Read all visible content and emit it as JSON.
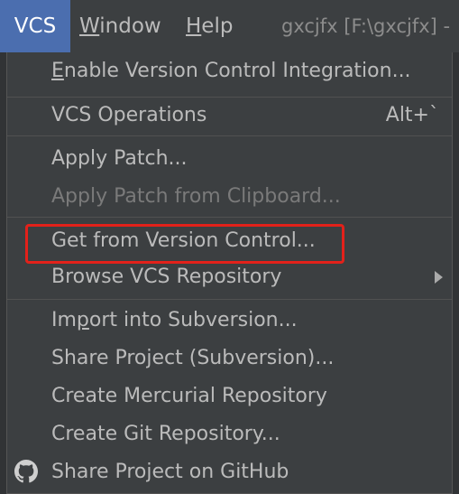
{
  "menubar": {
    "vcs": "VCS",
    "window_mnemonic": "W",
    "window_rest": "indow",
    "help_mnemonic": "H",
    "help_rest": "elp",
    "title": "gxcjfx [F:\\gxcjfx] -"
  },
  "vcs_menu": {
    "enable_mnemonic": "E",
    "enable_rest": "nable Version Control Integration...",
    "vcs_operations": "VCS Operations",
    "vcs_operations_shortcut": "Alt+`",
    "apply_patch": "Apply Patch...",
    "apply_patch_clipboard": "Apply Patch from Clipboard...",
    "get_from_vcs": "Get from Version Control...",
    "browse_vcs": "Browse VCS Repository",
    "import_prefix": "Im",
    "import_mnemonic": "p",
    "import_rest": "ort into Subversion...",
    "share_svn": "Share Project (Subversion)...",
    "create_hg": "Create Mercurial Repository",
    "create_git": "Create Git Repository...",
    "share_github": "Share Project on GitHub"
  },
  "annotation": {
    "highlight_color": "#e3211a"
  },
  "colors": {
    "menu_bg": "#3c3f41",
    "active_bg": "#4b6eaf",
    "text": "#bbbbbb",
    "disabled_text": "#7a7a7a"
  }
}
